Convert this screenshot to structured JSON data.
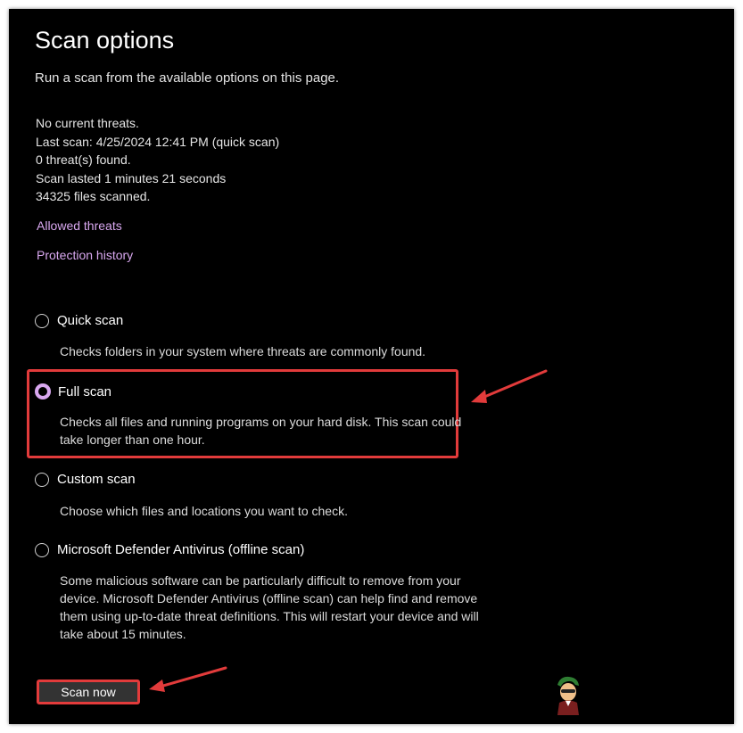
{
  "page": {
    "title": "Scan options",
    "subtitle": "Run a scan from the available options on this page."
  },
  "status": {
    "threats": "No current threats.",
    "last_scan": "Last scan: 4/25/2024 12:41 PM (quick scan)",
    "found": "0 threat(s) found.",
    "duration": "Scan lasted 1 minutes 21 seconds",
    "files": "34325 files scanned."
  },
  "links": {
    "allowed_threats": "Allowed threats",
    "protection_history": "Protection history"
  },
  "options": [
    {
      "label": "Quick scan",
      "description": "Checks folders in your system where threats are commonly found.",
      "selected": false
    },
    {
      "label": "Full scan",
      "description": "Checks all files and running programs on your hard disk. This scan could take longer than one hour.",
      "selected": true
    },
    {
      "label": "Custom scan",
      "description": "Choose which files and locations you want to check.",
      "selected": false
    },
    {
      "label": "Microsoft Defender Antivirus (offline scan)",
      "description": "Some malicious software can be particularly difficult to remove from your device. Microsoft Defender Antivirus (offline scan) can help find and remove them using up-to-date threat definitions. This will restart your device and will take about 15 minutes.",
      "selected": false
    }
  ],
  "actions": {
    "scan_now": "Scan now"
  },
  "colors": {
    "background": "#000000",
    "accent": "#d9a8f0",
    "annotation": "#e23b3b",
    "button": "#333333"
  },
  "icons": {
    "annotation_arrow": "arrow-icon",
    "watermark": "appuals-logo"
  }
}
